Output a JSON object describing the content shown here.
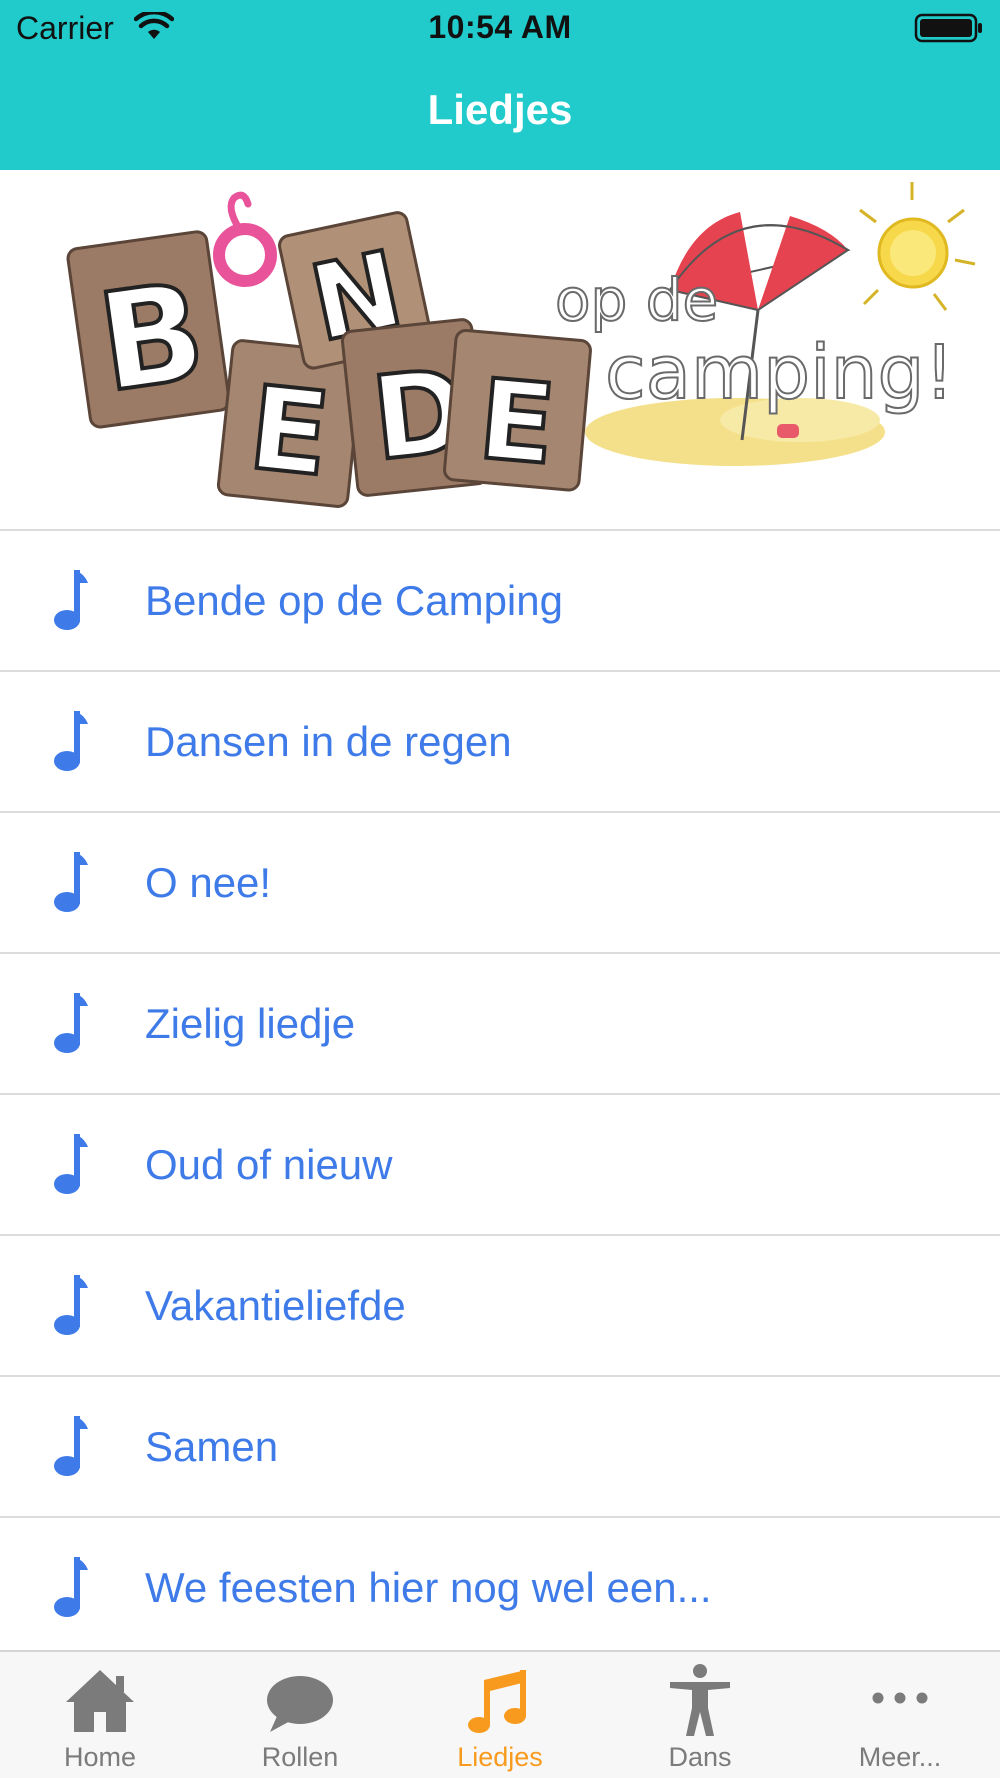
{
  "status_bar": {
    "carrier": "Carrier",
    "time": "10:54 AM"
  },
  "nav": {
    "title": "Liedjes",
    "background": "#21cbcb"
  },
  "banner": {
    "letters": [
      "B",
      "E",
      "N",
      "D",
      "E"
    ],
    "line1": "op de",
    "line2": "camping!"
  },
  "songs": [
    {
      "label": "Bende op de Camping",
      "icon": "music-note-icon"
    },
    {
      "label": "Dansen in de regen",
      "icon": "music-note-icon"
    },
    {
      "label": "O nee!",
      "icon": "music-note-icon"
    },
    {
      "label": "Zielig liedje",
      "icon": "music-note-icon"
    },
    {
      "label": "Oud of nieuw",
      "icon": "music-note-icon"
    },
    {
      "label": "Vakantieliefde",
      "icon": "music-note-icon"
    },
    {
      "label": "Samen",
      "icon": "music-note-icon"
    },
    {
      "label": "We feesten hier nog wel een...",
      "icon": "music-note-icon"
    }
  ],
  "tabs": [
    {
      "label": "Home",
      "icon": "home-icon",
      "active": false
    },
    {
      "label": "Rollen",
      "icon": "speech-bubble-icon",
      "active": false
    },
    {
      "label": "Liedjes",
      "icon": "music-notes-icon",
      "active": true
    },
    {
      "label": "Dans",
      "icon": "person-icon",
      "active": false
    },
    {
      "label": "Meer...",
      "icon": "more-icon",
      "active": false
    }
  ],
  "colors": {
    "accent_blue": "#3e7be9",
    "active_tab": "#f79a1e",
    "inactive_tab": "#7b7b7b"
  }
}
